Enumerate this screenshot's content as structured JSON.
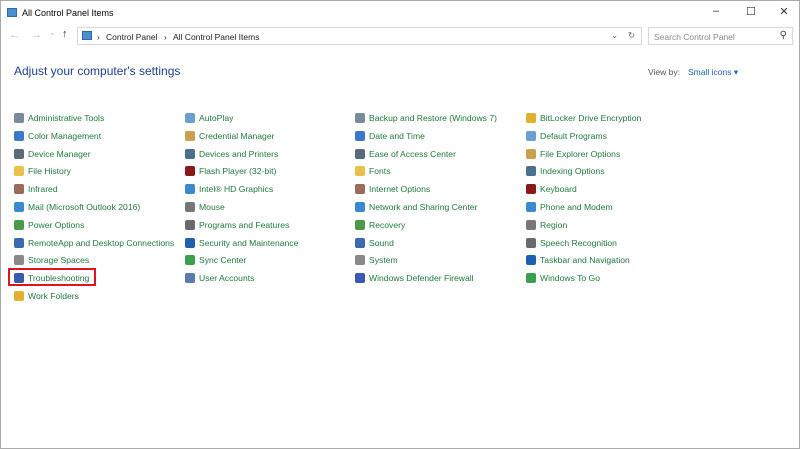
{
  "window": {
    "title": "All Control Panel Items",
    "minimize": "‒",
    "maximize": "☐",
    "close": "✕"
  },
  "address": {
    "back": "←",
    "forward": "→",
    "recent": "⌄",
    "up": "↑",
    "crumbs": [
      "Control Panel",
      "All Control Panel Items"
    ],
    "sep": "›",
    "dropdown": "⌄",
    "refresh": "↻"
  },
  "search": {
    "placeholder": "Search Control Panel",
    "icon": "⚲"
  },
  "heading": "Adjust your computer's settings",
  "view_by": {
    "label": "View by:",
    "value": "Small icons ▾"
  },
  "columns": [
    [
      "Administrative Tools",
      "Color Management",
      "Device Manager",
      "File History",
      "Infrared",
      "Mail (Microsoft Outlook 2016)",
      "Power Options",
      "RemoteApp and Desktop Connections",
      "Storage Spaces",
      "Troubleshooting",
      "Work Folders"
    ],
    [
      "AutoPlay",
      "Credential Manager",
      "Devices and Printers",
      "Flash Player (32-bit)",
      "Intel® HD Graphics",
      "Mouse",
      "Programs and Features",
      "Security and Maintenance",
      "Sync Center",
      "User Accounts"
    ],
    [
      "Backup and Restore (Windows 7)",
      "Date and Time",
      "Ease of Access Center",
      "Fonts",
      "Internet Options",
      "Network and Sharing Center",
      "Recovery",
      "Sound",
      "System",
      "Windows Defender Firewall"
    ],
    [
      "BitLocker Drive Encryption",
      "Default Programs",
      "File Explorer Options",
      "Indexing Options",
      "Keyboard",
      "Phone and Modem",
      "Region",
      "Speech Recognition",
      "Taskbar and Navigation",
      "Windows To Go"
    ]
  ],
  "icon_colors": [
    "#7a8a9a",
    "#3a78c8",
    "#5a6a7a",
    "#e8c04a",
    "#9a6a5a",
    "#3a8ad0",
    "#4a9a4a",
    "#3a6ab0",
    "#8a8a8a",
    "#3a5ab0",
    "#e0b030",
    "#6aa0d0",
    "#c8a050",
    "#4a7090",
    "#8a1a1a",
    "#3a8ad0",
    "#777",
    "#6a6a6a",
    "#2060b0",
    "#3aa050",
    "#5a7ab0"
  ],
  "highlight_color": "#e0141e"
}
